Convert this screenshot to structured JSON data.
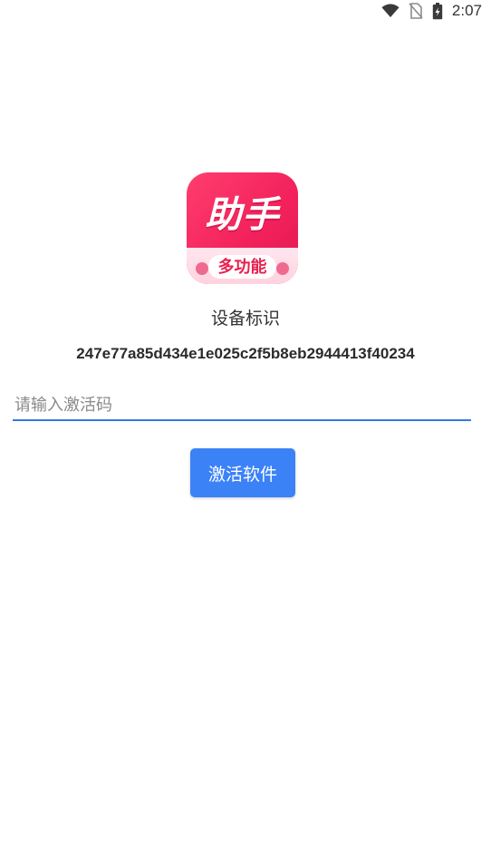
{
  "status_bar": {
    "time": "2:07",
    "icons": [
      "wifi-icon",
      "no-sim-icon",
      "battery-charging-icon"
    ]
  },
  "app_icon": {
    "main_text": "助手",
    "sub_text": "多功能",
    "colors": {
      "primary": "#f2205b",
      "band": "#ffd3e0"
    }
  },
  "device": {
    "label": "设备标识",
    "id": "247e77a85d434e1e025c2f5b8eb2944413f40234"
  },
  "activation": {
    "input_value": "",
    "input_placeholder": "请输入激活码",
    "button_label": "激活软件",
    "accent_color": "#3c82f7"
  }
}
